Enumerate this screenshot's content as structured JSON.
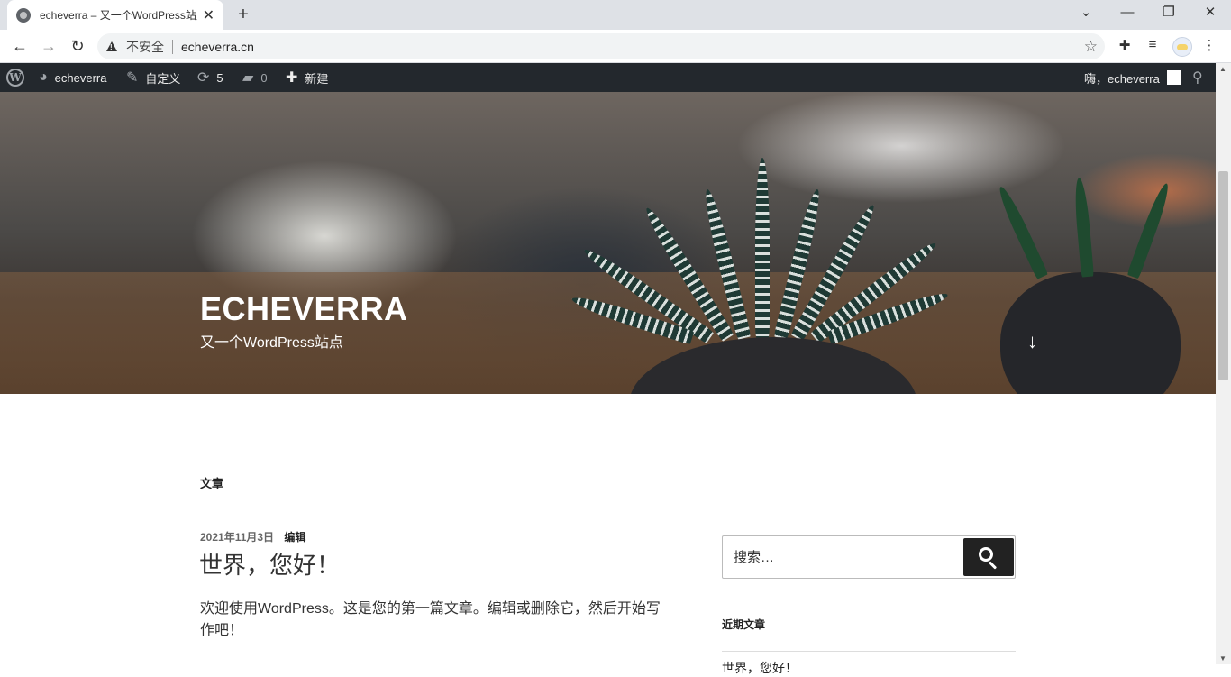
{
  "browser": {
    "tab_title": "echeverra – 又一个WordPress站点",
    "tab_close": "✕",
    "new_tab": "+",
    "window_controls": {
      "minimize": "—",
      "maximize": "❐",
      "close": "✕",
      "tab_search": "⌄"
    },
    "nav": {
      "back": "←",
      "forward": "→",
      "reload": "↻"
    },
    "security_label": "不安全",
    "url": "echeverra.cn",
    "toolbar_icons": [
      "star-icon",
      "extensions-icon",
      "media-control-icon",
      "profile-avatar",
      "menu-icon"
    ]
  },
  "admin_bar": {
    "logo": "W",
    "site_name": "echeverra",
    "customize": "自定义",
    "updates_count": "5",
    "comments_count": "0",
    "new_label": "新建",
    "greeting": "嗨，echeverra"
  },
  "hero": {
    "site_title": "ECHEVERRA",
    "tagline": "又一个WordPress站点",
    "scroll_arrow": "↓"
  },
  "main": {
    "section_title": "文章",
    "post": {
      "date": "2021年11月3日",
      "edit_label": "编辑",
      "title": "世界，您好！",
      "excerpt": "欢迎使用WordPress。这是您的第一篇文章。编辑或删除它，然后开始写作吧！"
    }
  },
  "sidebar": {
    "search_placeholder": "搜索…",
    "recent_posts_title": "近期文章",
    "recent_posts": [
      "世界，您好！"
    ]
  },
  "colors": {
    "admin_bar_bg": "#23282d",
    "tabstrip_bg": "#dee1e6",
    "search_button_bg": "#222222"
  }
}
